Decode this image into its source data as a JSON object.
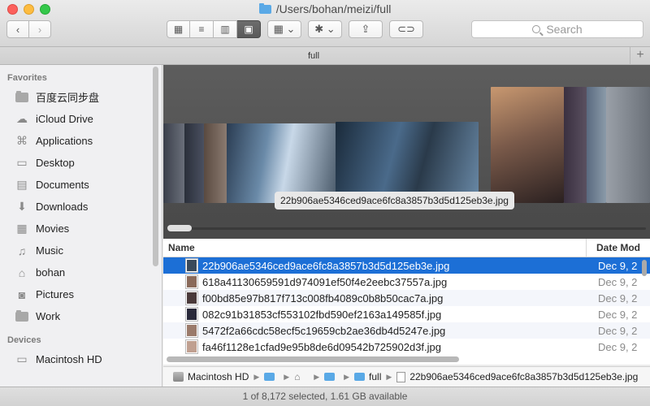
{
  "window": {
    "title": "/Users/bohan/meizi/full"
  },
  "toolbar": {
    "back_glyph": "‹",
    "forward_glyph": "›",
    "view_modes": [
      {
        "name": "icon-view",
        "glyph": "▦"
      },
      {
        "name": "list-view",
        "glyph": "≡"
      },
      {
        "name": "column-view",
        "glyph": "▥"
      },
      {
        "name": "cover-flow-view",
        "glyph": "▣",
        "active": true
      }
    ],
    "arrange_glyph": "▦ ⌄",
    "action_glyph": "✱ ⌄",
    "share_glyph": "⇪",
    "tags_glyph": "⊂⊃",
    "search_placeholder": "Search"
  },
  "tab": {
    "label": "full",
    "add_glyph": "+"
  },
  "sidebar": {
    "favorites_header": "Favorites",
    "favorites": [
      {
        "label": "百度云同步盘",
        "icon": "folder-icon"
      },
      {
        "label": "iCloud Drive",
        "icon": "cloud-icon"
      },
      {
        "label": "Applications",
        "icon": "applications-icon"
      },
      {
        "label": "Desktop",
        "icon": "desktop-icon"
      },
      {
        "label": "Documents",
        "icon": "documents-icon"
      },
      {
        "label": "Downloads",
        "icon": "downloads-icon"
      },
      {
        "label": "Movies",
        "icon": "movies-icon"
      },
      {
        "label": "Music",
        "icon": "music-icon"
      },
      {
        "label": "bohan",
        "icon": "home-icon"
      },
      {
        "label": "Pictures",
        "icon": "pictures-icon"
      },
      {
        "label": "Work",
        "icon": "folder-icon"
      }
    ],
    "devices_header": "Devices",
    "devices": [
      {
        "label": "Macintosh HD",
        "icon": "hard-drive-icon"
      }
    ]
  },
  "coverflow": {
    "caption": "22b906ae5346ced9ace6fc8a3857b3d5d125eb3e.jpg"
  },
  "list": {
    "col_name": "Name",
    "col_date": "Date Mod",
    "rows": [
      {
        "name": "22b906ae5346ced9ace6fc8a3857b3d5d125eb3e.jpg",
        "date": "Dec 9, 2",
        "selected": true
      },
      {
        "name": "618a41130659591d974091ef50f4e2eebc37557a.jpg",
        "date": "Dec 9, 2"
      },
      {
        "name": "f00bd85e97b817f713c008fb4089c0b8b50cac7a.jpg",
        "date": "Dec 9, 2"
      },
      {
        "name": "082c91b31853cf553102fbd590ef2163a149585f.jpg",
        "date": "Dec 9, 2"
      },
      {
        "name": "5472f2a66cdc58ecf5c19659cb2ae36db4d5247e.jpg",
        "date": "Dec 9, 2"
      },
      {
        "name": "fa46f1128e1cfad9e95b8de6d09542b725902d3f.jpg",
        "date": "Dec 9, 2"
      }
    ]
  },
  "pathbar": {
    "items": [
      "Macintosh HD",
      "",
      "",
      "",
      "full",
      "22b906ae5346ced9ace6fc8a3857b3d5d125eb3e.jpg"
    ]
  },
  "status": {
    "text": "1 of 8,172 selected, 1.61 GB available"
  },
  "colors": {
    "selection": "#1c6fd6",
    "folder_blue": "#5aa9e6"
  }
}
